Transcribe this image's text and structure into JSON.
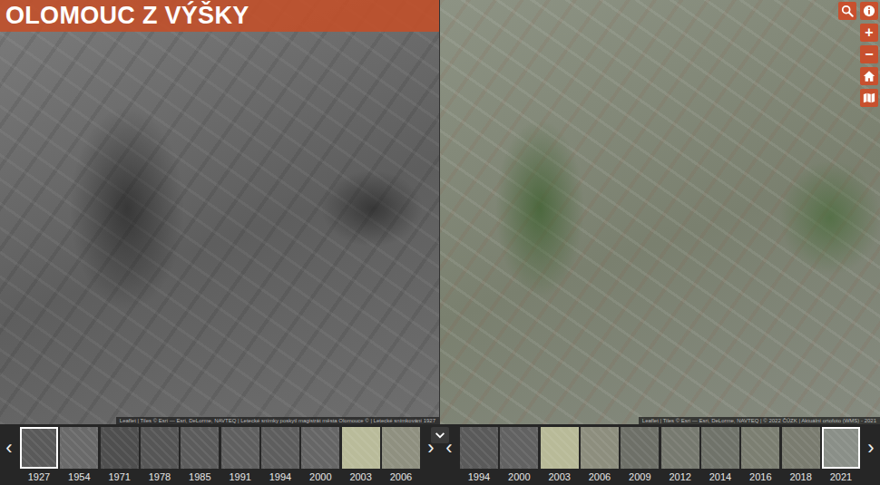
{
  "app": {
    "title": "OLOMOUC Z VÝŠKY"
  },
  "panes": [
    {
      "attribution": "Leaflet | Tiles © Esri — Esri, DeLorme, NAVTEQ | Letecké snímky poskytl magistrát města Olomouce © | Letecké snímkování 1927"
    },
    {
      "attribution": "Leaflet | Tiles © Esri — Esri, DeLorme, NAVTEQ | © 2022 ČÚZK | Aktuální ortofoto (WMS) - 2021"
    }
  ],
  "controls": {
    "zoom_in": "+",
    "zoom_out": "−"
  },
  "timelines": [
    {
      "prev": "‹",
      "next": "›",
      "items": [
        {
          "year": "1927",
          "selected": true,
          "color": "#5a5a5a"
        },
        {
          "year": "1954",
          "selected": false,
          "color": "#6a6a6a"
        },
        {
          "year": "1971",
          "selected": false,
          "color": "#4f4f4f"
        },
        {
          "year": "1978",
          "selected": false,
          "color": "#565656"
        },
        {
          "year": "1985",
          "selected": false,
          "color": "#5c5c5c"
        },
        {
          "year": "1991",
          "selected": false,
          "color": "#606060"
        },
        {
          "year": "1994",
          "selected": false,
          "color": "#5e5e5e"
        },
        {
          "year": "2000",
          "selected": false,
          "color": "#666666"
        },
        {
          "year": "2003",
          "selected": false,
          "color": "#b9bb9a"
        },
        {
          "year": "2006",
          "selected": false,
          "color": "#8f9080"
        }
      ]
    },
    {
      "prev": "‹",
      "next": "›",
      "items": [
        {
          "year": "1994",
          "selected": false,
          "color": "#5a5a5a"
        },
        {
          "year": "2000",
          "selected": false,
          "color": "#626262"
        },
        {
          "year": "2003",
          "selected": false,
          "color": "#b8ba98"
        },
        {
          "year": "2006",
          "selected": false,
          "color": "#8d8e7e"
        },
        {
          "year": "2009",
          "selected": false,
          "color": "#6e7068"
        },
        {
          "year": "2012",
          "selected": false,
          "color": "#777a70"
        },
        {
          "year": "2014",
          "selected": false,
          "color": "#70736a"
        },
        {
          "year": "2016",
          "selected": false,
          "color": "#7c7f72"
        },
        {
          "year": "2018",
          "selected": false,
          "color": "#7a7c70"
        },
        {
          "year": "2021",
          "selected": true,
          "color": "#8a8f88"
        }
      ]
    }
  ]
}
